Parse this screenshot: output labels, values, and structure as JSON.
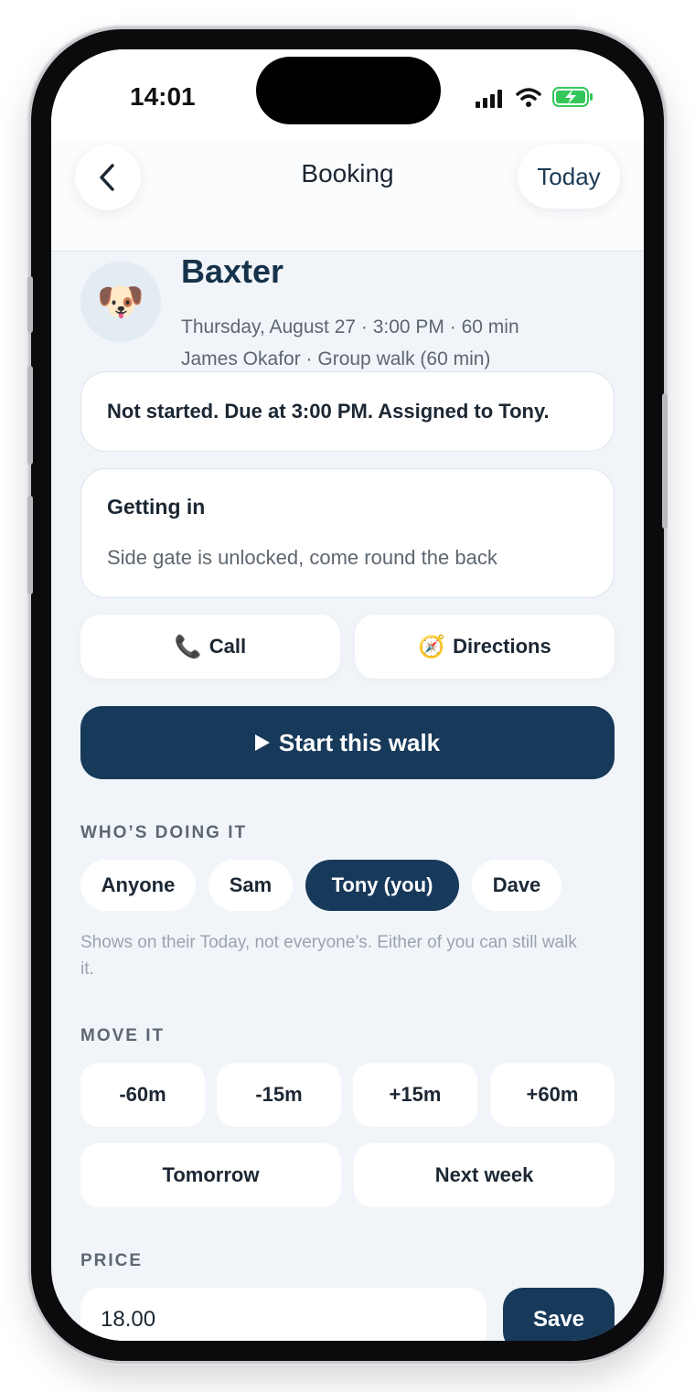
{
  "status_bar": {
    "time": "14:01"
  },
  "nav": {
    "title": "Booking",
    "today_label": "Today"
  },
  "booking": {
    "pet_name": "Baxter",
    "avatar_emoji": "🐶",
    "schedule": "Thursday, August 27 · 3:00 PM · 60 min",
    "client_service": "James Okafor · Group walk (60 min)"
  },
  "status_message": "Not started. Due at 3:00 PM. Assigned to Tony.",
  "getting_in": {
    "title": "Getting in",
    "body": "Side gate is unlocked, come round the back"
  },
  "actions": {
    "call_icon": "📞",
    "call_label": "Call",
    "directions_icon": "🧭",
    "directions_label": "Directions",
    "start_label": "Start this walk"
  },
  "assignment": {
    "label": "WHO’S DOING IT",
    "options": [
      "Anyone",
      "Sam",
      "Tony (you)",
      "Dave"
    ],
    "selected": "Tony (you)",
    "hint": "Shows on their Today, not everyone’s. Either of you can still walk it."
  },
  "move": {
    "label": "MOVE IT",
    "buttons": [
      "-60m",
      "-15m",
      "+15m",
      "+60m",
      "Tomorrow",
      "Next week"
    ]
  },
  "price": {
    "label": "PRICE",
    "value": "18.00",
    "save_label": "Save"
  },
  "colors": {
    "primary": "#17395a",
    "background": "#f1f5f9",
    "muted_text": "#5d6670"
  }
}
